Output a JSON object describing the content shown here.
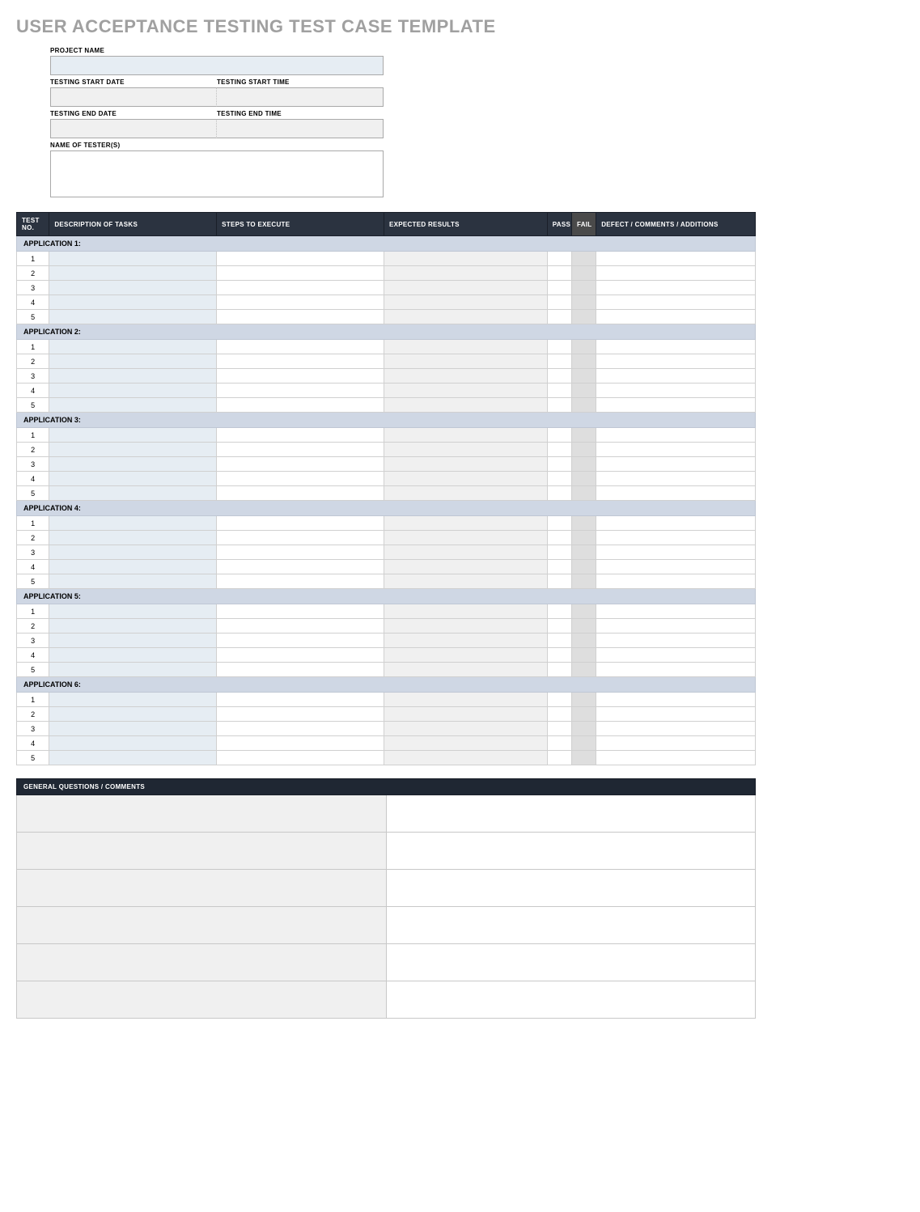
{
  "title": "USER ACCEPTANCE TESTING TEST CASE TEMPLATE",
  "meta": {
    "project_name_label": "PROJECT NAME",
    "project_name": "",
    "testing_start_date_label": "TESTING START DATE",
    "testing_start_date": "",
    "testing_start_time_label": "TESTING START TIME",
    "testing_start_time": "",
    "testing_end_date_label": "TESTING END DATE",
    "testing_end_date": "",
    "testing_end_time_label": "TESTING END TIME",
    "testing_end_time": "",
    "name_of_testers_label": "NAME OF TESTER(S)",
    "name_of_testers": ""
  },
  "columns": {
    "test_no": "TEST NO.",
    "description": "DESCRIPTION OF TASKS",
    "steps": "STEPS TO EXECUTE",
    "expected": "EXPECTED RESULTS",
    "pass": "PASS",
    "fail": "FAIL",
    "defect": "DEFECT / COMMENTS / ADDITIONS"
  },
  "sections": [
    {
      "label": "APPLICATION 1:",
      "rows": [
        {
          "n": "1"
        },
        {
          "n": "2"
        },
        {
          "n": "3"
        },
        {
          "n": "4"
        },
        {
          "n": "5"
        }
      ]
    },
    {
      "label": "APPLICATION 2:",
      "rows": [
        {
          "n": "1"
        },
        {
          "n": "2"
        },
        {
          "n": "3"
        },
        {
          "n": "4"
        },
        {
          "n": "5"
        }
      ]
    },
    {
      "label": "APPLICATION 3:",
      "rows": [
        {
          "n": "1"
        },
        {
          "n": "2"
        },
        {
          "n": "3"
        },
        {
          "n": "4"
        },
        {
          "n": "5"
        }
      ]
    },
    {
      "label": "APPLICATION 4:",
      "rows": [
        {
          "n": "1"
        },
        {
          "n": "2"
        },
        {
          "n": "3"
        },
        {
          "n": "4"
        },
        {
          "n": "5"
        }
      ]
    },
    {
      "label": "APPLICATION 5:",
      "rows": [
        {
          "n": "1"
        },
        {
          "n": "2"
        },
        {
          "n": "3"
        },
        {
          "n": "4"
        },
        {
          "n": "5"
        }
      ]
    },
    {
      "label": "APPLICATION 6:",
      "rows": [
        {
          "n": "1"
        },
        {
          "n": "2"
        },
        {
          "n": "3"
        },
        {
          "n": "4"
        },
        {
          "n": "5"
        }
      ]
    }
  ],
  "general": {
    "header": "GENERAL QUESTIONS / COMMENTS",
    "rows": [
      {},
      {},
      {},
      {},
      {},
      {}
    ]
  }
}
